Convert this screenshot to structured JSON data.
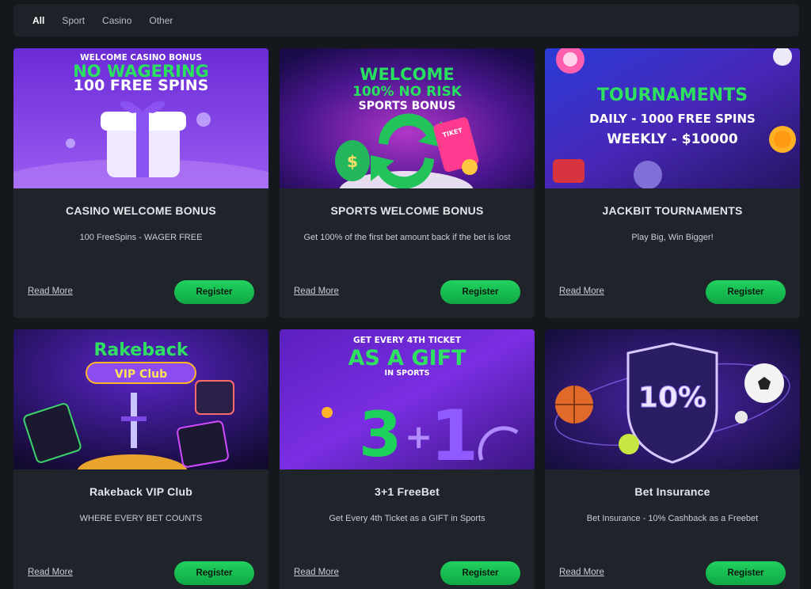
{
  "filters": [
    "All",
    "Sport",
    "Casino",
    "Other"
  ],
  "active_filter": "All",
  "cards": [
    {
      "banner": {
        "line1": "WELCOME CASINO BONUS",
        "line2": "NO WAGERING",
        "line3": "100 FREE SPINS"
      },
      "title": "CASINO WELCOME BONUS",
      "description": "100 FreeSpins - WAGER FREE",
      "read_more": "Read More",
      "register": "Register"
    },
    {
      "banner": {
        "line1": "WELCOME",
        "line2": "100% NO RISK",
        "line3": "SPORTS BONUS",
        "ticket": "TIKET"
      },
      "title": "SPORTS WELCOME BONUS",
      "description": "Get 100% of the first bet amount back if the bet is lost",
      "read_more": "Read More",
      "register": "Register"
    },
    {
      "banner": {
        "line1": "TOURNAMENTS",
        "line2": "DAILY - 1000 FREE SPINS",
        "line3": "WEEKLY - $10000"
      },
      "title": "JACKBIT TOURNAMENTS",
      "description": "Play Big, Win Bigger!",
      "read_more": "Read More",
      "register": "Register"
    },
    {
      "banner": {
        "line1": "Rakeback",
        "line2": "VIP Club"
      },
      "title": "Rakeback VIP Club",
      "description": "WHERE EVERY BET COUNTS",
      "read_more": "Read More",
      "register": "Register"
    },
    {
      "banner": {
        "line1": "GET EVERY 4TH TICKET",
        "line2": "AS A GIFT",
        "line3": "IN SPORTS"
      },
      "title": "3+1 FreeBet",
      "description": "Get Every 4th Ticket as a GIFT in Sports",
      "read_more": "Read More",
      "register": "Register"
    },
    {
      "banner": {
        "line1": "10%"
      },
      "title": "Bet Insurance",
      "description": "Bet Insurance - 10% Cashback as a Freebet",
      "read_more": "Read More",
      "register": "Register"
    }
  ],
  "colors": {
    "background": "#14171c",
    "card": "#1f232a",
    "accent_green": "#18c152"
  }
}
